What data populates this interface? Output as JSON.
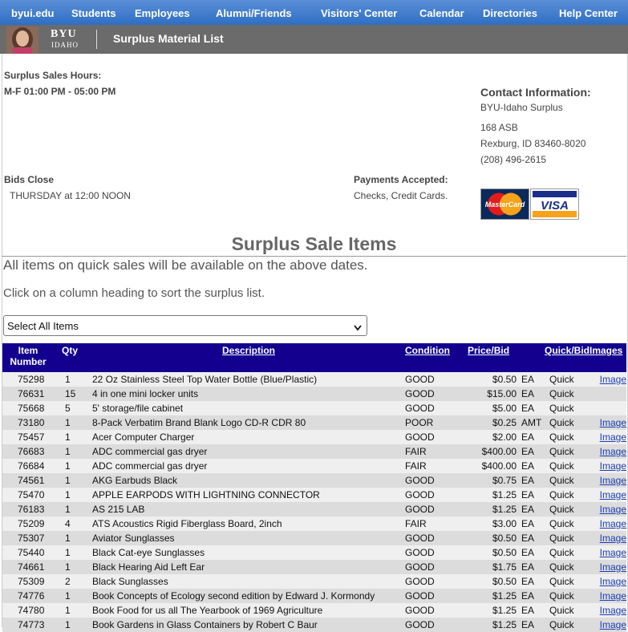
{
  "nav": [
    "byui.edu",
    "Students",
    "Employees",
    "Alumni/Friends",
    "Visitors' Center",
    "Calendar",
    "Directories",
    "Help Center"
  ],
  "header": {
    "logo_top": "BYU",
    "logo_bottom": "IDAHO",
    "title": "Surplus Material List"
  },
  "hours": {
    "label": "Surplus Sales Hours:",
    "value": "M-F  01:00 PM - 05:00 PM"
  },
  "bids": {
    "label": "Bids Close",
    "value": "THURSDAY at 12:00 NOON"
  },
  "payments": {
    "label": "Payments Accepted:",
    "value": "Checks, Credit Cards.",
    "cards": [
      "MasterCard",
      "VISA"
    ]
  },
  "contact": {
    "title": "Contact Information:",
    "lines": [
      "BYU-Idaho Surplus",
      "168 ASB",
      "Rexburg, ID 83460-8020",
      "(208) 496-2615"
    ]
  },
  "sale_title": "Surplus Sale Items",
  "info1": "All items on quick sales will be available on the above dates.",
  "info2": "Click on a column heading to sort the surplus list.",
  "select_value": "Select All Items",
  "columns": {
    "item": "Item Number",
    "qty": "Qty",
    "desc": "Description",
    "cond": "Condition",
    "price": "Price/Bid",
    "quick": "Quick/Bid",
    "images": "Images"
  },
  "rows": [
    [
      "75298",
      "1",
      "22 Oz Stainless Steel Top Water Bottle (Blue/Plastic)",
      "GOOD",
      "$0.50",
      "EA",
      "Quick",
      "Image"
    ],
    [
      "76631",
      "15",
      "4 in one mini locker units",
      "GOOD",
      "$15.00",
      "EA",
      "Quick",
      ""
    ],
    [
      "75668",
      "5",
      "5' storage/file cabinet",
      "GOOD",
      "$5.00",
      "EA",
      "Quick",
      ""
    ],
    [
      "73180",
      "1",
      "8-Pack Verbatim Brand Blank Logo CD-R CDR 80",
      "POOR",
      "$0.25",
      "AMT",
      "Quick",
      "Image"
    ],
    [
      "75457",
      "1",
      "Acer Computer Charger",
      "GOOD",
      "$2.00",
      "EA",
      "Quick",
      "Image"
    ],
    [
      "76683",
      "1",
      "ADC commercial gas dryer",
      "FAIR",
      "$400.00",
      "EA",
      "Quick",
      "Image"
    ],
    [
      "76684",
      "1",
      "ADC commercial gas dryer",
      "FAIR",
      "$400.00",
      "EA",
      "Quick",
      "Image"
    ],
    [
      "74561",
      "1",
      "AKG Earbuds Black",
      "GOOD",
      "$0.75",
      "EA",
      "Quick",
      "Image"
    ],
    [
      "75470",
      "1",
      "APPLE EARPODS WITH LIGHTNING CONNECTOR",
      "GOOD",
      "$1.25",
      "EA",
      "Quick",
      "Image"
    ],
    [
      "76183",
      "1",
      "AS 215 LAB",
      "GOOD",
      "$1.25",
      "EA",
      "Quick",
      "Image"
    ],
    [
      "75209",
      "4",
      "ATS Acoustics Rigid Fiberglass Board, 2inch",
      "FAIR",
      "$3.00",
      "EA",
      "Quick",
      "Image"
    ],
    [
      "75307",
      "1",
      "Aviator Sunglasses",
      "GOOD",
      "$0.50",
      "EA",
      "Quick",
      "Image"
    ],
    [
      "75440",
      "1",
      "Black Cat-eye Sunglasses",
      "GOOD",
      "$0.50",
      "EA",
      "Quick",
      "Image"
    ],
    [
      "74661",
      "1",
      "Black Hearing Aid Left Ear",
      "GOOD",
      "$1.75",
      "EA",
      "Quick",
      "Image"
    ],
    [
      "75309",
      "2",
      "Black Sunglasses",
      "GOOD",
      "$0.50",
      "EA",
      "Quick",
      "Image"
    ],
    [
      "74776",
      "1",
      "Book Concepts of Ecology second edition by Edward J. Kormondy",
      "GOOD",
      "$1.25",
      "EA",
      "Quick",
      "Image"
    ],
    [
      "74780",
      "1",
      "Book Food for us all The Yearbook of 1969 Agriculture",
      "GOOD",
      "$1.25",
      "EA",
      "Quick",
      "Image"
    ],
    [
      "74773",
      "1",
      "Book Gardens in Glass Containers by Robert C Baur",
      "GOOD",
      "$1.25",
      "EA",
      "Quick",
      "Image"
    ]
  ]
}
